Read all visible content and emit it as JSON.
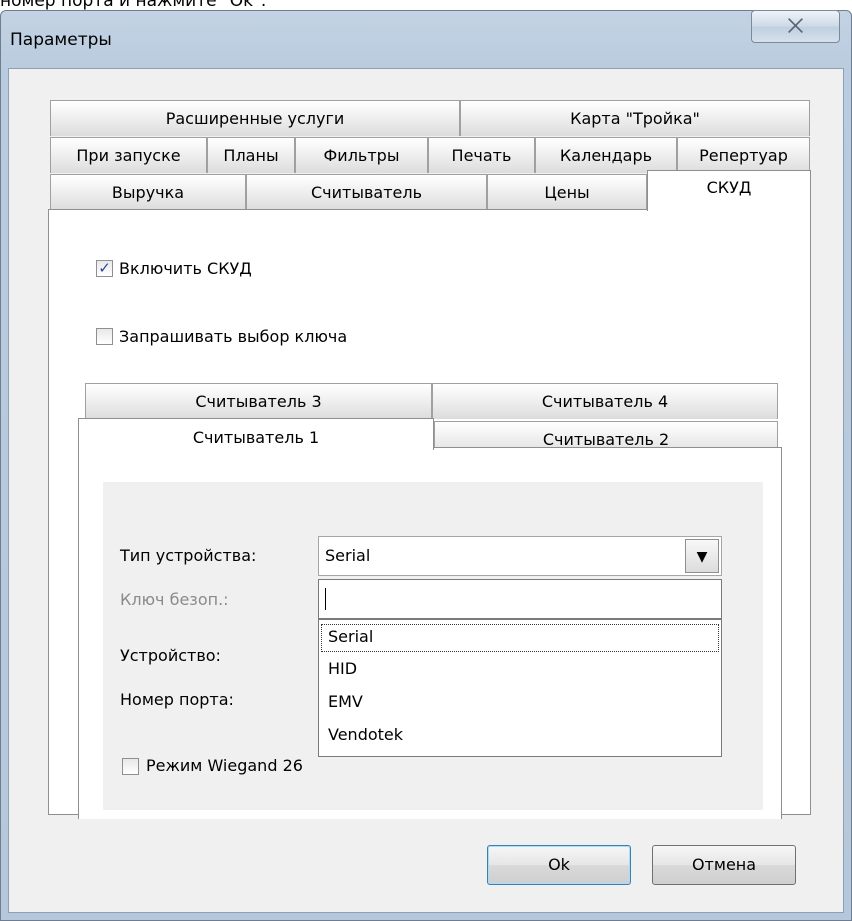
{
  "top_fragment": "номер порта и нажмите \"Ok\".",
  "window": {
    "title": "Параметры",
    "close_glyph": "⨉"
  },
  "tabs": {
    "row1": [
      "Расширенные услуги",
      "Карта \"Тройка\""
    ],
    "row2": [
      "При запуске",
      "Планы",
      "Фильтры",
      "Печать",
      "Календарь",
      "Репертуар"
    ],
    "row3": [
      "Выручка",
      "Считыватель",
      "Цены",
      "СКУД"
    ],
    "active": "СКУД"
  },
  "options": {
    "enable_skud": {
      "label": "Включить СКУД",
      "checked": true,
      "mark": "✓"
    },
    "ask_key": {
      "label": "Запрашивать выбор ключа",
      "checked": false
    }
  },
  "reader_tabs": {
    "row_back": [
      "Считыватель 3",
      "Считыватель 4"
    ],
    "row_front": [
      "Считыватель 1",
      "Считыватель 2"
    ],
    "active": "Считыватель 1"
  },
  "form": {
    "device_type_label": "Тип устройства:",
    "device_type_value": "Serial",
    "security_key_label": "Ключ безоп.:",
    "device_label": "Устройство:",
    "port_label": "Номер порта:",
    "wiegand_label": "Режим Wiegand 26",
    "dropdown_arrow": "▼"
  },
  "dropdown": {
    "items": [
      "Serial",
      "HID",
      "EMV",
      "Vendotek"
    ],
    "selected": "Serial"
  },
  "buttons": {
    "ok": "Ok",
    "cancel": "Отмена"
  },
  "colors": {
    "accent": "#3c7fb1",
    "titlebar": "#b9cbde",
    "disabled_text": "#8a8a8a"
  }
}
